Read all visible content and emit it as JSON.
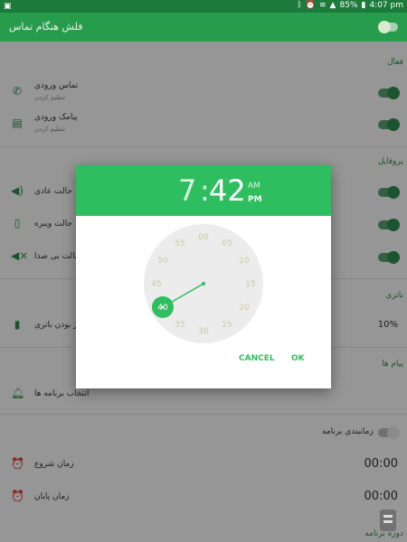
{
  "status_bar": {
    "left_icon": "image-icon",
    "battery": "85%",
    "time": "4:07 pm"
  },
  "app_bar": {
    "title": "فلش هنگام تماس"
  },
  "sections": {
    "active": "فعال",
    "profiles": "پروفایل",
    "battery": "باتری",
    "message": "پیام ها",
    "period": "دوره برنامه"
  },
  "rows": {
    "incoming_call": {
      "title": "تماس ورودی",
      "subtitle": "تنظیم کردن",
      "icon": "phone-icon"
    },
    "incoming_sms": {
      "title": "پیامک ورودی",
      "subtitle": "تنظیم کردن",
      "icon": "message-icon"
    },
    "normal_mode": {
      "title": "حالت عادی",
      "icon": "volume-icon"
    },
    "vibrate_mode": {
      "title": "حالت ویبره",
      "icon": "vibrate-icon"
    },
    "silent_mode": {
      "title": "حالت بی صدا",
      "icon": "mute-icon"
    },
    "low_battery": {
      "title": "سطح شارژ بودن باتری",
      "value": "10%",
      "icon": "battery-icon"
    },
    "select_apps": {
      "title": "انتخاب برنامه ها",
      "icon": "bell-icon"
    },
    "schedule": {
      "title": "زمانبندی برنامه"
    },
    "start_time": {
      "title": "زمان شروع",
      "value": "00:00",
      "icon": "alarm-icon"
    },
    "end_time": {
      "title": "زمان پایان",
      "value": "00:00",
      "icon": "alarm-icon"
    }
  },
  "time_picker": {
    "hour": "7",
    "separator": ":",
    "minute": "42",
    "am": "AM",
    "pm": "PM",
    "selected_minute": 40,
    "minute_labels": [
      "00",
      "05",
      "10",
      "15",
      "20",
      "25",
      "30",
      "35",
      "40",
      "45",
      "50",
      "55"
    ],
    "cancel": "CANCEL",
    "ok": "OK"
  },
  "colors": {
    "accent": "#2fbe5f",
    "app_bar": "#279c4c",
    "status_bar": "#1c7a3a"
  }
}
